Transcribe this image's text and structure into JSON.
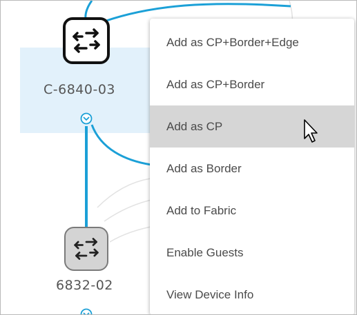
{
  "topology": {
    "nodes": [
      {
        "name": "C-6840-03",
        "selected": true,
        "icon": "switch-arrows-icon"
      },
      {
        "name": "6832-02",
        "selected": false,
        "icon": "switch-arrows-icon"
      }
    ],
    "link_color": "#1ba0d7",
    "highlight_color": "#e2f1fb"
  },
  "context_menu": {
    "items": [
      {
        "label": "Add as CP+Border+Edge"
      },
      {
        "label": "Add as CP+Border"
      },
      {
        "label": "Add as CP",
        "active": true
      },
      {
        "label": "Add as Border"
      },
      {
        "label": "Add to Fabric"
      },
      {
        "label": "Enable Guests"
      },
      {
        "label": "View Device Info"
      }
    ]
  }
}
